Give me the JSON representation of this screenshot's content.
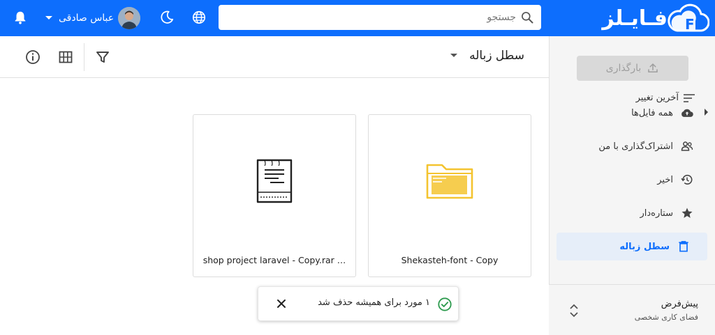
{
  "brand": {
    "name": "فـایـلز",
    "color": "#0d6efd"
  },
  "header": {
    "search_placeholder": "جستجو",
    "user_name": "عباس صادقی",
    "icons": [
      "search-icon",
      "globe-icon",
      "moon-icon",
      "chevron-down-icon",
      "bell-icon"
    ]
  },
  "sidebar": {
    "upload_label": "بارگذاری",
    "items": [
      {
        "label": "همه فایل‌ها",
        "icon": "cloud-upload-icon"
      },
      {
        "label": "اشتراک‌گذاری با من",
        "icon": "people-icon"
      },
      {
        "label": "اخیر",
        "icon": "history-icon"
      },
      {
        "label": "ستاره‌دار",
        "icon": "star-icon"
      },
      {
        "label": "سطل زباله",
        "icon": "trash-icon",
        "active": true
      }
    ],
    "workspace": {
      "title": "پیش‌فرض",
      "subtitle": "فضای کاری شخصی"
    }
  },
  "main": {
    "breadcrumb": "سطل زباله",
    "sort_label": "آخرین تغییر",
    "files": [
      {
        "name": "Shekasteh-font - Copy",
        "type": "folder"
      },
      {
        "name": "shop project laravel - Copy.rar …",
        "type": "archive"
      }
    ]
  },
  "toast": {
    "message": "۱ مورد برای همیشه حذف شد"
  },
  "colors": {
    "accent": "#0d6efd",
    "folder": "#f4c430",
    "active_bg": "#e6eef9"
  }
}
